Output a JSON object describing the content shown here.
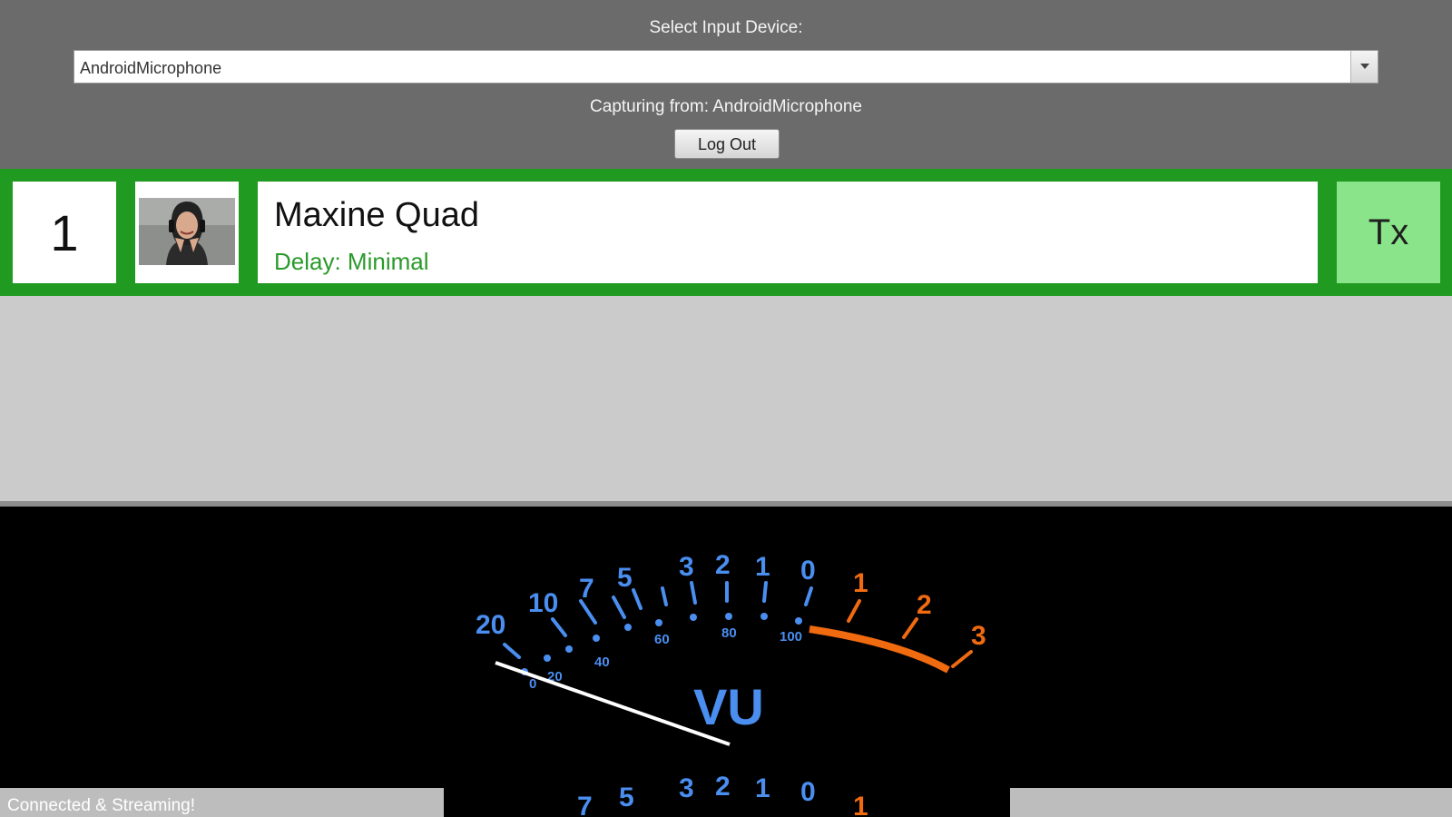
{
  "header": {
    "select_label": "Select Input Device:",
    "selected_device": "AndroidMicrophone",
    "capturing_text": "Capturing from: AndroidMicrophone",
    "logout_label": "Log Out"
  },
  "contact": {
    "slot": "1",
    "name": "Maxine Quad",
    "delay": "Delay: Minimal",
    "tx_label": "Tx",
    "avatar_icon": "person-avatar-icon"
  },
  "vu_meter": {
    "title": "VU",
    "db_scale": [
      "20",
      "10",
      "7",
      "5",
      "3",
      "2",
      "1",
      "0",
      "1",
      "2",
      "3"
    ],
    "percent_scale": [
      "0",
      "20",
      "40",
      "60",
      "80",
      "100"
    ],
    "lower_scale": [
      "7",
      "5",
      "3",
      "2",
      "1",
      "0",
      "1"
    ],
    "colors": {
      "normal": "#4a8ef0",
      "over": "#f06a10",
      "needle": "#ffffff",
      "background": "#000000"
    }
  },
  "status": {
    "text": "Connected & Streaming!"
  },
  "colors": {
    "top_panel": "#6b6b6b",
    "contact_border": "#219a21",
    "tx_button": "#8ae58a",
    "delay_text": "#2a9a2a"
  }
}
